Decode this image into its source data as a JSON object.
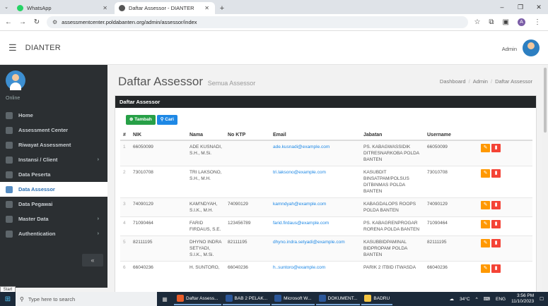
{
  "browser": {
    "tabs": [
      {
        "title": "WhatsApp",
        "icon": "whatsapp-icon",
        "color": "#25d366"
      },
      {
        "title": "Daftar Assessor - DIANTER",
        "icon": "site-icon",
        "color": "#555555"
      }
    ],
    "url": "assessmentcenter.poldabanten.org/admin/assessor/index"
  },
  "app": {
    "brand": "DIANTER",
    "user_label": "Admin"
  },
  "sidebar": {
    "status": "Online",
    "items": [
      {
        "label": "Home",
        "icon": "home-icon"
      },
      {
        "label": "Assessment Center",
        "icon": "target-icon"
      },
      {
        "label": "Riwayat Assessment",
        "icon": "history-icon"
      },
      {
        "label": "Instansi / Client",
        "icon": "building-icon",
        "arrow": true
      },
      {
        "label": "Data Peserta",
        "icon": "users-icon"
      },
      {
        "label": "Data Assessor",
        "icon": "user-icon",
        "active": true
      },
      {
        "label": "Data Pegawai",
        "icon": "staff-icon"
      },
      {
        "label": "Master Data",
        "icon": "database-icon",
        "arrow": true
      },
      {
        "label": "Authentication",
        "icon": "lock-icon",
        "arrow": true
      }
    ],
    "collapse_label": "«"
  },
  "page": {
    "title": "Daftar Assessor",
    "subtitle": "Semua Assessor",
    "breadcrumb": [
      "Dashboard",
      "Admin",
      "Daftar Assessor"
    ],
    "card_title": "Daftar Assessor",
    "add_button": "Tambah",
    "search_button": "Cari"
  },
  "table": {
    "headers": [
      "#",
      "NIK",
      "Nama",
      "No KTP",
      "Email",
      "Jabatan",
      "Username"
    ],
    "rows": [
      {
        "no": "1",
        "nik": "66050099",
        "nama": "ADE KUSNADI, S.H., M.Si.",
        "ktp": "",
        "email": "ade.kusnadi@example.com",
        "jabatan": "PS. KABAGWASSIDIK DITRESNARKOBA POLDA BANTEN",
        "username": "66050099"
      },
      {
        "no": "2",
        "nik": "73010708",
        "nama": "TRI LAKSONO, S.H., M.H.",
        "ktp": "",
        "email": "tri.laksono@example.com",
        "jabatan": "KASUBDIT BINSATPAM/POLSUS DITBINMAS POLDA BANTEN",
        "username": "73010708"
      },
      {
        "no": "3",
        "nik": "74090129",
        "nama": "KAM'NDYAH, S.I.K., M.H.",
        "ktp": "74090129",
        "email": "kamndyah@example.com",
        "jabatan": "KABAGDALOPS ROOPS POLDA BANTEN",
        "username": "74090129"
      },
      {
        "no": "4",
        "nik": "71090464",
        "nama": "FARID FIRDAUS, S.E.",
        "ktp": "123456789",
        "email": "farid.firdaus@example.com",
        "jabatan": "PS. KABAGRENPROGAR RORENA POLDA BANTEN",
        "username": "71090464"
      },
      {
        "no": "5",
        "nik": "82111195",
        "nama": "DHYNO INDRA SETYADI, S.I.K., M.Si.",
        "ktp": "82111195",
        "email": "dhyno.indra.setyadi@example.com",
        "jabatan": "KASUBBIDPAMINAL BIDPROPAM POLDA BANTEN",
        "username": "82111195"
      },
      {
        "no": "6",
        "nik": "66040236",
        "nama": "H. SUNTORO,",
        "ktp": "66040236",
        "email": "h..suntoro@example.com",
        "jabatan": "PARIK 2 ITBID ITWASDA",
        "username": "66040236"
      }
    ]
  },
  "taskbar": {
    "search_placeholder": "Type here to search",
    "apps": [
      {
        "label": "Daftar Assess...",
        "color": "#e85d2a"
      },
      {
        "label": "BAB 2 PELAK...",
        "color": "#2b579a"
      },
      {
        "label": "Microsoft W...",
        "color": "#2b579a"
      },
      {
        "label": "DOKUMENT...",
        "color": "#2b579a"
      },
      {
        "label": "BADRU",
        "color": "#f4c542"
      }
    ],
    "weather": "34°C",
    "lang": "ENG",
    "time": "3:56 PM",
    "date": "11/10/2023"
  },
  "start_label": "Start"
}
